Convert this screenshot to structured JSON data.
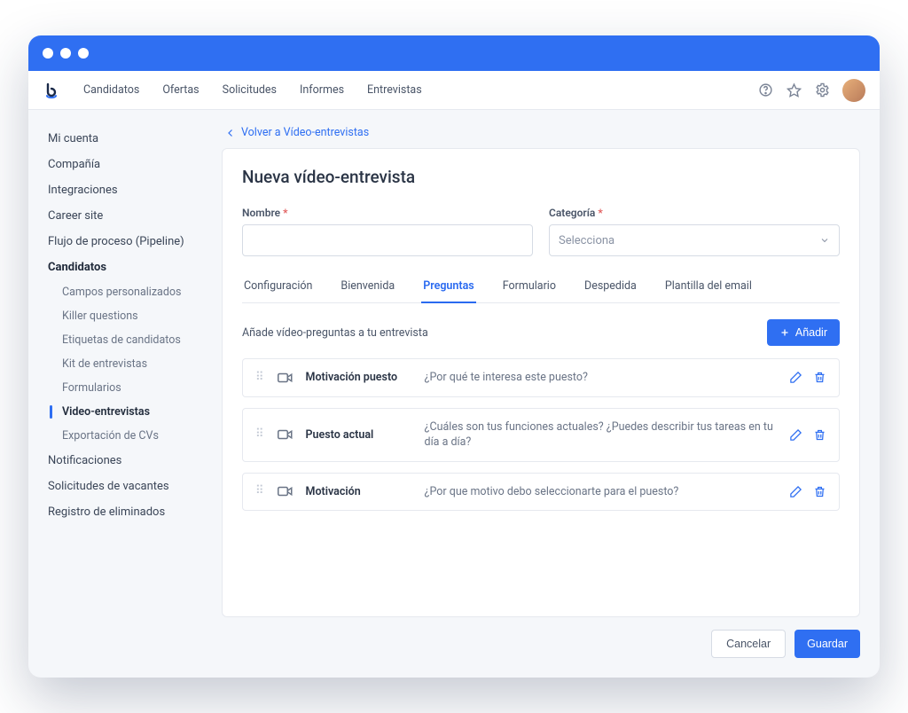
{
  "topnav": {
    "items": [
      "Candidatos",
      "Ofertas",
      "Solicitudes",
      "Informes",
      "Entrevistas"
    ]
  },
  "sidebar": {
    "links": [
      {
        "label": "Mi cuenta"
      },
      {
        "label": "Compañía"
      },
      {
        "label": "Integraciones"
      },
      {
        "label": "Career site"
      },
      {
        "label": "Flujo de proceso (Pipeline)"
      }
    ],
    "candidates_label": "Candidatos",
    "candidates_sub": [
      {
        "label": "Campos personalizados"
      },
      {
        "label": "Killer questions"
      },
      {
        "label": "Etiquetas de candidatos"
      },
      {
        "label": "Kit de entrevistas"
      },
      {
        "label": "Formularios"
      },
      {
        "label": "Video-entrevistas"
      },
      {
        "label": "Exportación de CVs"
      }
    ],
    "tail": [
      {
        "label": "Notificaciones"
      },
      {
        "label": "Solicitudes de vacantes"
      },
      {
        "label": "Registro de eliminados"
      }
    ]
  },
  "backlink": "Volver a Vídeo-entrevistas",
  "page_title": "Nueva vídeo-entrevista",
  "form": {
    "name_label": "Nombre",
    "category_label": "Categoría",
    "category_placeholder": "Selecciona"
  },
  "tabs": [
    "Configuración",
    "Bienvenida",
    "Preguntas",
    "Formulario",
    "Despedida",
    "Plantilla del email"
  ],
  "tabs_active_index": 2,
  "section_text": "Añade vídeo-preguntas a tu entrevista",
  "add_button": "Añadir",
  "questions": [
    {
      "title": "Motivación puesto",
      "text": "¿Por qué te interesa este puesto?"
    },
    {
      "title": "Puesto actual",
      "text": "¿Cuáles son tus funciones actuales? ¿Puedes describir tus tareas en tu día a día?"
    },
    {
      "title": "Motivación",
      "text": "¿Por que motivo debo seleccionarte para el puesto?"
    }
  ],
  "footer": {
    "cancel": "Cancelar",
    "save": "Guardar"
  }
}
